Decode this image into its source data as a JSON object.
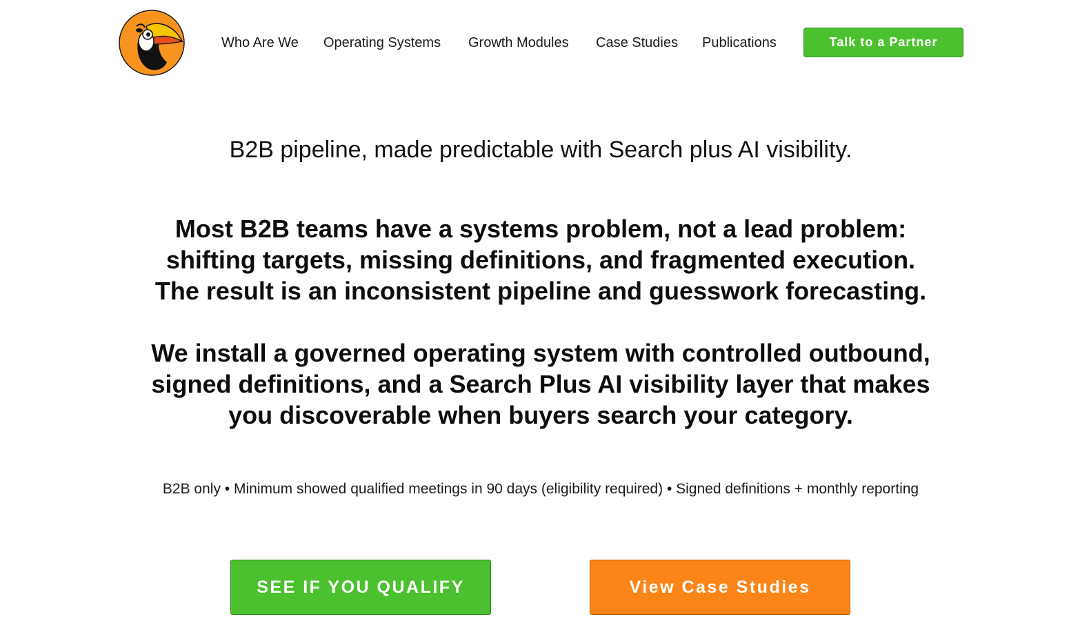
{
  "header": {
    "logo_name": "toucan-logo",
    "nav": [
      {
        "label": "Who Are We"
      },
      {
        "label": "Operating Systems"
      },
      {
        "label": "Growth Modules"
      },
      {
        "label": "Case Studies"
      },
      {
        "label": "Publications"
      }
    ],
    "cta_label": "Talk to a Partner"
  },
  "hero": {
    "tagline": "B2B pipeline, made predictable with Search plus AI visibility.",
    "problem_lines": [
      "Most B2B teams have a systems problem, not a lead problem:",
      "shifting targets, missing definitions, and fragmented execution.",
      "The result is an inconsistent pipeline and guesswork forecasting."
    ],
    "solution_lines": [
      "We install a governed operating system with controlled outbound,",
      "signed definitions, and a Search Plus AI visibility layer that makes",
      "you discoverable when buyers search your category."
    ],
    "proof_points": "B2B only • Minimum showed qualified meetings in 90 days (eligibility required) • Signed definitions + monthly reporting",
    "primary_button": "SEE IF YOU QUALIFY",
    "secondary_button": "View Case Studies"
  },
  "colors": {
    "green": "#4cc12f",
    "orange": "#fb8518",
    "text": "#111111"
  }
}
